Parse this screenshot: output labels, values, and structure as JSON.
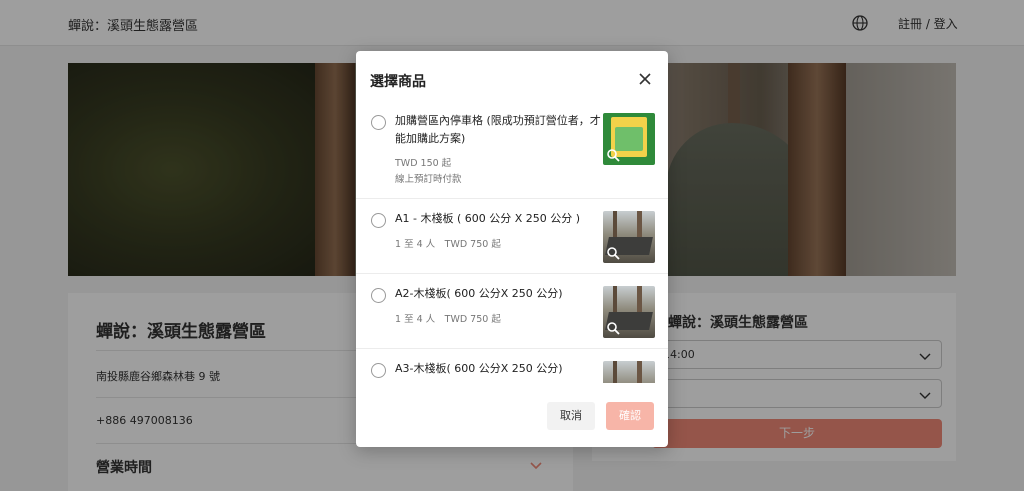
{
  "header": {
    "brand": "蟬說：溪頭生態露營區",
    "auth_label": "註冊 / 登入"
  },
  "campsite": {
    "name": "蟬說：溪頭生態露營區",
    "address": "南投縣鹿谷鄉森林巷 9 號",
    "phone": "+886 497008136",
    "hours_label": "營業時間"
  },
  "booking": {
    "title": "蟬說：溪頭生態露營區",
    "time_value": "14:00",
    "second_value": "",
    "next_label": "下一步"
  },
  "modal": {
    "title": "選擇商品",
    "cancel_label": "取消",
    "confirm_label": "確認",
    "items": [
      {
        "name": "加購營區內停車格 (限成功預訂營位者，才能加購此方案)",
        "meta1": "TWD 150 起",
        "meta2": "線上預訂時付款",
        "thumb": "map"
      },
      {
        "name": "A1 - 木棧板 ( 600 公分 X 250 公分 )",
        "meta1": "1 至 4 人　TWD 750 起",
        "meta2": "",
        "thumb": "photo"
      },
      {
        "name": "A2-木棧板( 600 公分X 250 公分)",
        "meta1": "1 至 4 人　TWD 750 起",
        "meta2": "",
        "thumb": "photo"
      },
      {
        "name": "A3-木棧板( 600 公分X 250 公分)",
        "meta1": "",
        "meta2": "",
        "thumb": "photo"
      }
    ]
  },
  "colors": {
    "accent": "#f08a78",
    "confirm_disabled": "#f7b5a8"
  }
}
